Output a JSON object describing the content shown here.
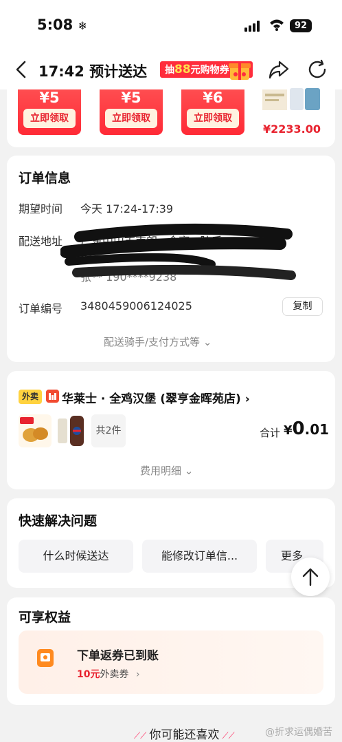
{
  "status_bar": {
    "time": "5:08",
    "snow": "❄",
    "battery": "92"
  },
  "nav": {
    "title": "17:42 预计送达",
    "promo_prefix": "抽",
    "promo_highlight": "88",
    "promo_suffix": "元购物券"
  },
  "coupons": [
    {
      "amount": "¥5",
      "button": "立即领取"
    },
    {
      "amount": "¥5",
      "button": "立即领取"
    },
    {
      "amount": "¥6",
      "button": "立即领取"
    }
  ],
  "product": {
    "price": "¥2233.00"
  },
  "order_info": {
    "title": "订单信息",
    "expected_label": "期望时间",
    "expected_value": "今天 17:24-17:39",
    "address_label": "配送地址",
    "address_line1": "广东中山市南朗...金亨...院后",
    "address_line2": "面",
    "address_line3": "张** 190****9238",
    "order_no_label": "订单编号",
    "order_no_value": "3480459006124025",
    "copy_label": "复制",
    "more_label": "配送骑手/支付方式等"
  },
  "store": {
    "tag": "外卖",
    "name": "华莱士 · 全鸡汉堡 (翠亨金晖苑店)",
    "item_count": "共2件",
    "total_label": "合计",
    "total_currency": "¥",
    "total_int": "0",
    "total_dec": ".01",
    "fee_label": "费用明细"
  },
  "quick_solve": {
    "title": "快速解决问题",
    "chips": [
      "什么时候送达",
      "能修改订单信...",
      "更多"
    ]
  },
  "benefits": {
    "title": "可享权益",
    "item_title": "下单返券已到账",
    "item_amount": "10元",
    "item_type": "外卖券"
  },
  "footer": {
    "recommend": "你可能还喜欢",
    "watermark": "@折求运偶婚苦"
  },
  "colors": {
    "accent_red": "#e8232f",
    "coupon_red": "#ff2d3c",
    "tag_yellow": "#ffd23f"
  }
}
